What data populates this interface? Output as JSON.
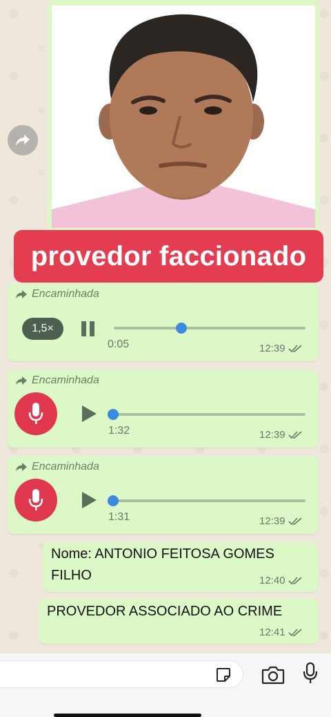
{
  "caption": "provedor faccionado",
  "forwarded_label": "Encaminhada",
  "voice_messages": [
    {
      "speed": "1,5×",
      "elapsed": "0:05",
      "time": "12:39",
      "state": "playing",
      "progress": 0.35
    },
    {
      "duration": "1:32",
      "time": "12:39",
      "state": "paused",
      "progress": 0
    },
    {
      "duration": "1:31",
      "time": "12:39",
      "state": "paused",
      "progress": 0
    }
  ],
  "text_messages": [
    {
      "text_line1": "Nome: ANTONIO FEITOSA GOMES",
      "text_line2": "FILHO",
      "time": "12:40"
    },
    {
      "text": "PROVEDOR ASSOCIADO AO CRIME",
      "time": "12:41"
    }
  ],
  "icons": {
    "forward": "forward-icon",
    "sticker": "sticker-icon",
    "camera": "camera-icon",
    "microphone": "microphone-icon",
    "read_receipt": "double-check-icon"
  },
  "colors": {
    "bubble": "#dcf8c6",
    "caption_banner": "#e43d51",
    "progress_knob": "#3c8ae0",
    "mic_avatar": "#e0394f"
  }
}
